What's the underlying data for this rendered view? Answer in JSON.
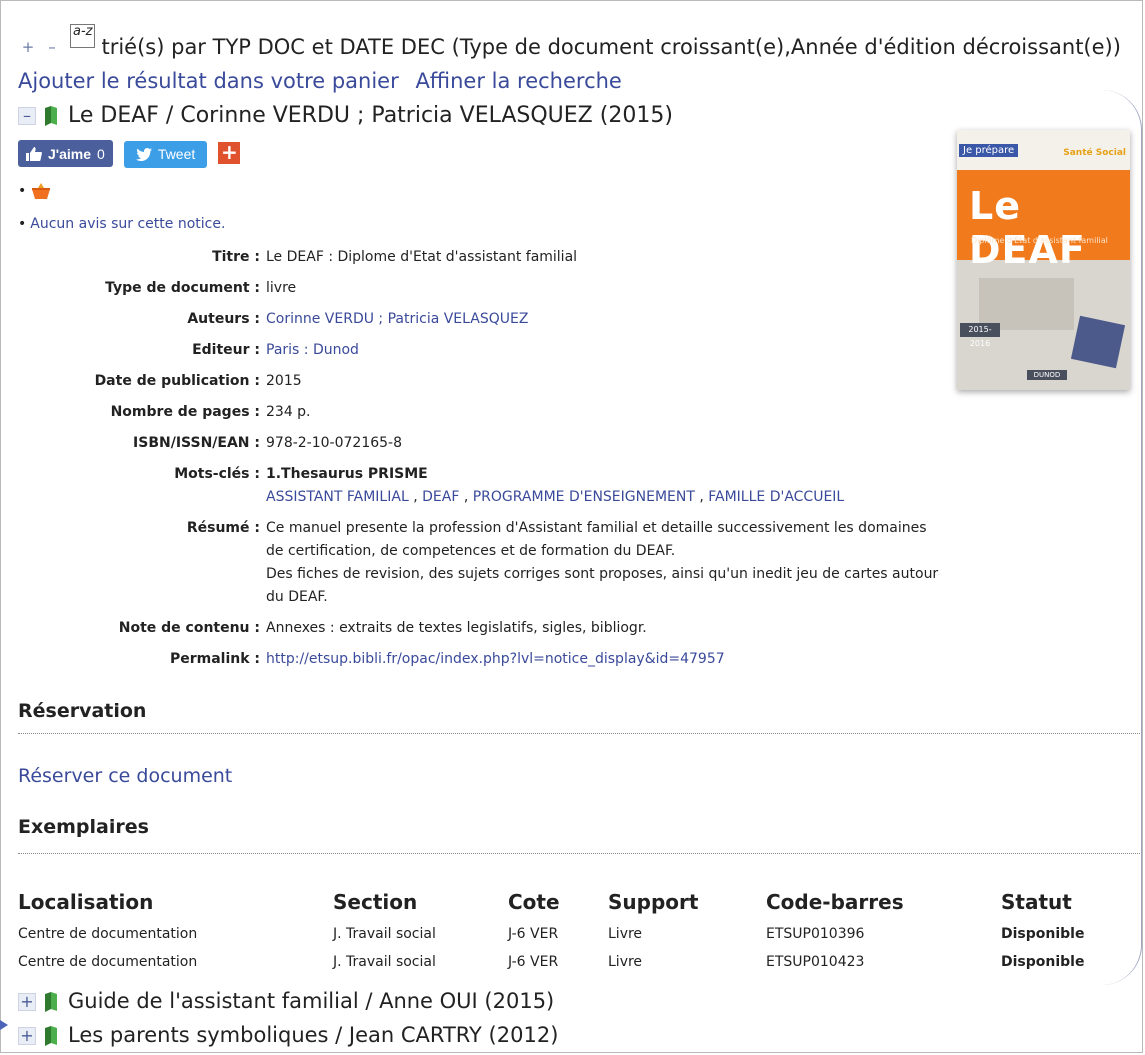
{
  "sortbar": {
    "text": "trié(s) par TYP DOC et DATE DEC (Type de document croissant(e),Année d'édition décroissant(e))",
    "az_label": "a-z",
    "add_cart": "Ajouter le résultat dans votre panier",
    "refine": "Affiner la recherche"
  },
  "record": {
    "title": "Le DEAF / Corinne VERDU ; Patricia VELASQUEZ (2015)",
    "like_label": "J'aime",
    "like_count": "0",
    "tweet_label": "Tweet",
    "plus_label": "+",
    "no_review": "Aucun avis sur cette notice.",
    "fields": {
      "titre_label": "Titre :",
      "titre": "Le DEAF : Diplome d'Etat d'assistant familial",
      "type_label": "Type de document :",
      "type": "livre",
      "auteurs_label": "Auteurs :",
      "auteurs": "Corinne VERDU ; Patricia VELASQUEZ",
      "editeur_label": "Editeur :",
      "editeur": "Paris : Dunod",
      "date_label": "Date de publication :",
      "date": "2015",
      "pages_label": "Nombre de pages :",
      "pages": "234 p.",
      "isbn_label": "ISBN/ISSN/EAN :",
      "isbn": "978-2-10-072165-8",
      "mots_label": "Mots-clés :",
      "mots_head": "1.Thesaurus PRISME",
      "keywords": [
        "ASSISTANT FAMILIAL",
        "DEAF",
        "PROGRAMME D'ENSEIGNEMENT",
        "FAMILLE D'ACCUEIL"
      ],
      "resume_label": "Résumé :",
      "resume_1": "Ce manuel presente la profession d'Assistant familial et detaille successivement les domaines de certification, de competences et de formation du DEAF.",
      "resume_2": "Des fiches de revision, des sujets corriges sont proposes, ainsi qu'un inedit jeu de cartes autour du DEAF.",
      "note_label": "Note de contenu :",
      "note": "Annexes : extraits de textes legislatifs, sigles, bibliogr.",
      "perma_label": "Permalink :",
      "perma": "http://etsup.bibli.fr/opac/index.php?lvl=notice_display&id=47957"
    },
    "cover": {
      "tag": "Je prépare",
      "brand": "Santé Social",
      "title": "Le DEAF",
      "subtitle": "Diplôme d'État d'assistant familial",
      "year": "2015-2016",
      "publisher": "DUNOD"
    }
  },
  "reservation": {
    "heading": "Réservation",
    "link": "Réserver ce document"
  },
  "exemplaires": {
    "heading": "Exemplaires",
    "columns": [
      "Localisation",
      "Section",
      "Cote",
      "Support",
      "Code-barres",
      "Statut"
    ],
    "rows": [
      [
        "Centre de documentation",
        "J. Travail social",
        "J-6 VER",
        "Livre",
        "ETSUP010396",
        "Disponible"
      ],
      [
        "Centre de documentation",
        "J. Travail social",
        "J-6 VER",
        "Livre",
        "ETSUP010423",
        "Disponible"
      ]
    ]
  },
  "siblings": [
    "Guide de l'assistant familial / Anne OUI (2015)",
    "Les parents symboliques / Jean CARTRY (2012)"
  ]
}
